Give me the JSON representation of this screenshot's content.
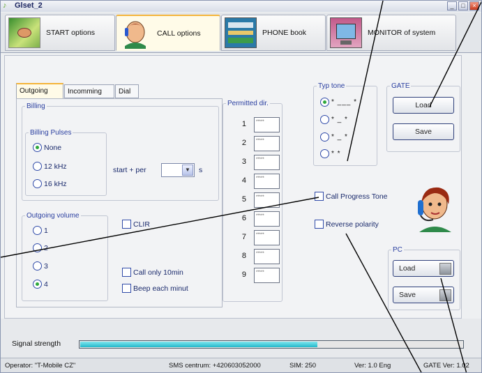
{
  "window": {
    "title": "Glset_2"
  },
  "main_tabs": [
    {
      "label": "START options"
    },
    {
      "label": "CALL options"
    },
    {
      "label": "PHONE book"
    },
    {
      "label": "MONITOR of system"
    }
  ],
  "sub_tabs": [
    {
      "label": "Outgoing"
    },
    {
      "label": "Incomming"
    },
    {
      "label": "Dial"
    }
  ],
  "billing": {
    "title": "Billing",
    "pulses_title": "Billing Pulses",
    "options": [
      {
        "label": "None",
        "selected": true
      },
      {
        "label": "12 kHz",
        "selected": false
      },
      {
        "label": "16 kHz",
        "selected": false
      }
    ],
    "start_per_label": "start + per",
    "unit": "s"
  },
  "outgoing_volume": {
    "title": "Outgoing volume",
    "options": [
      {
        "label": "1",
        "selected": false
      },
      {
        "label": "2",
        "selected": false
      },
      {
        "label": "3",
        "selected": false
      },
      {
        "label": "4",
        "selected": true
      }
    ]
  },
  "checkboxes": {
    "clir": "CLIR",
    "call_only": "Call only 10min",
    "beep": "Beep each minut",
    "call_progress": "Call Progress Tone",
    "reverse": "Reverse polarity"
  },
  "permitted": {
    "title": "Permitted dir.",
    "rows": [
      {
        "num": "1",
        "value": "*****"
      },
      {
        "num": "2",
        "value": "*****"
      },
      {
        "num": "3",
        "value": "*****"
      },
      {
        "num": "4",
        "value": "*****"
      },
      {
        "num": "5",
        "value": "*****"
      },
      {
        "num": "6",
        "value": "*****"
      },
      {
        "num": "7",
        "value": "*****"
      },
      {
        "num": "8",
        "value": "*****"
      },
      {
        "num": "9",
        "value": "*****"
      }
    ]
  },
  "typ_tone": {
    "title": "Typ tone",
    "options": [
      {
        "pattern": "* ___ *",
        "selected": true
      },
      {
        "pattern": "* _ *",
        "selected": false
      },
      {
        "pattern": "* _ *",
        "selected": false
      },
      {
        "pattern": "* *",
        "selected": false
      }
    ]
  },
  "gate": {
    "title": "GATE",
    "load": "Load",
    "save": "Save"
  },
  "pc": {
    "title": "PC",
    "load": "Load",
    "save": "Save"
  },
  "signal": {
    "label": "Signal strength",
    "level_fraction": 0.62
  },
  "status": {
    "operator": "Operator: \"T-Mobile CZ\"",
    "sms": "SMS centrum: +420603052000",
    "sim": "SIM: 250",
    "ver": "Ver: 1.0 Eng",
    "gate_ver": "GATE Ver: 1.02"
  },
  "colors": {
    "accent": "#f4b43a",
    "signal": "#22b8c9",
    "selected_dot": "#2fa83c"
  },
  "icons": [
    "window-icon",
    "start-phone-icon",
    "operator-icon",
    "phonebook-icon",
    "monitor-icon"
  ]
}
